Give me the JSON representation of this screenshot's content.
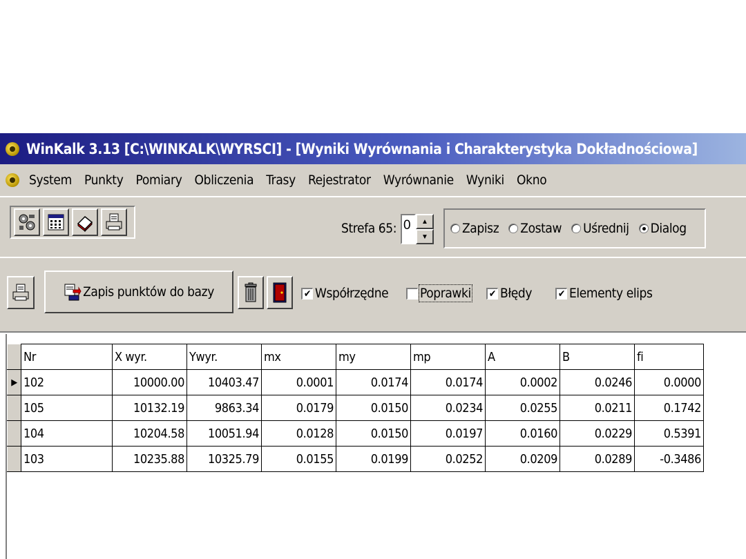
{
  "window": {
    "title": "WinKalk 3.13 [C:\\WINKALK\\WYRSCI] - [Wyniki Wyrównania i Charakterystyka Dokładnościowa]"
  },
  "menu": [
    "System",
    "Punkty",
    "Pomiary",
    "Obliczenia",
    "Trasy",
    "Rejestrator",
    "Wyrównanie",
    "Wyniki",
    "Okno"
  ],
  "toolbar1": {
    "icons": [
      "settings-icon",
      "calculator-icon",
      "eraser-icon",
      "print-icon"
    ],
    "strefa_label": "Strefa 65:",
    "strefa_value": "0",
    "radios": [
      {
        "label": "Zapisz",
        "checked": false
      },
      {
        "label": "Zostaw",
        "checked": false
      },
      {
        "label": "Uśrednij",
        "checked": false
      },
      {
        "label": "Dialog",
        "checked": true
      }
    ]
  },
  "toolbar2": {
    "save_label": "Zapis punktów do bazy",
    "checks": [
      {
        "label": "Współrzędne",
        "checked": true
      },
      {
        "label": "Poprawki",
        "checked": false
      },
      {
        "label": "Błędy",
        "checked": true
      },
      {
        "label": "Elementy elips",
        "checked": true
      }
    ]
  },
  "grid": {
    "columns": [
      "Nr",
      "X wyr.",
      "Ywyr.",
      "mx",
      "my",
      "mp",
      "A",
      "B",
      "fi"
    ],
    "rows": [
      [
        "102",
        "10000.00",
        "10403.47",
        "0.0001",
        "0.0174",
        "0.0174",
        "0.0002",
        "0.0246",
        "0.0000"
      ],
      [
        "105",
        "10132.19",
        "9863.34",
        "0.0179",
        "0.0150",
        "0.0234",
        "0.0255",
        "0.0211",
        "0.1742"
      ],
      [
        "104",
        "10204.58",
        "10051.94",
        "0.0128",
        "0.0150",
        "0.0197",
        "0.0160",
        "0.0229",
        "0.5391"
      ],
      [
        "103",
        "10235.88",
        "10325.79",
        "0.0155",
        "0.0199",
        "0.0252",
        "0.0209",
        "0.0289",
        "-0.3486"
      ]
    ]
  }
}
